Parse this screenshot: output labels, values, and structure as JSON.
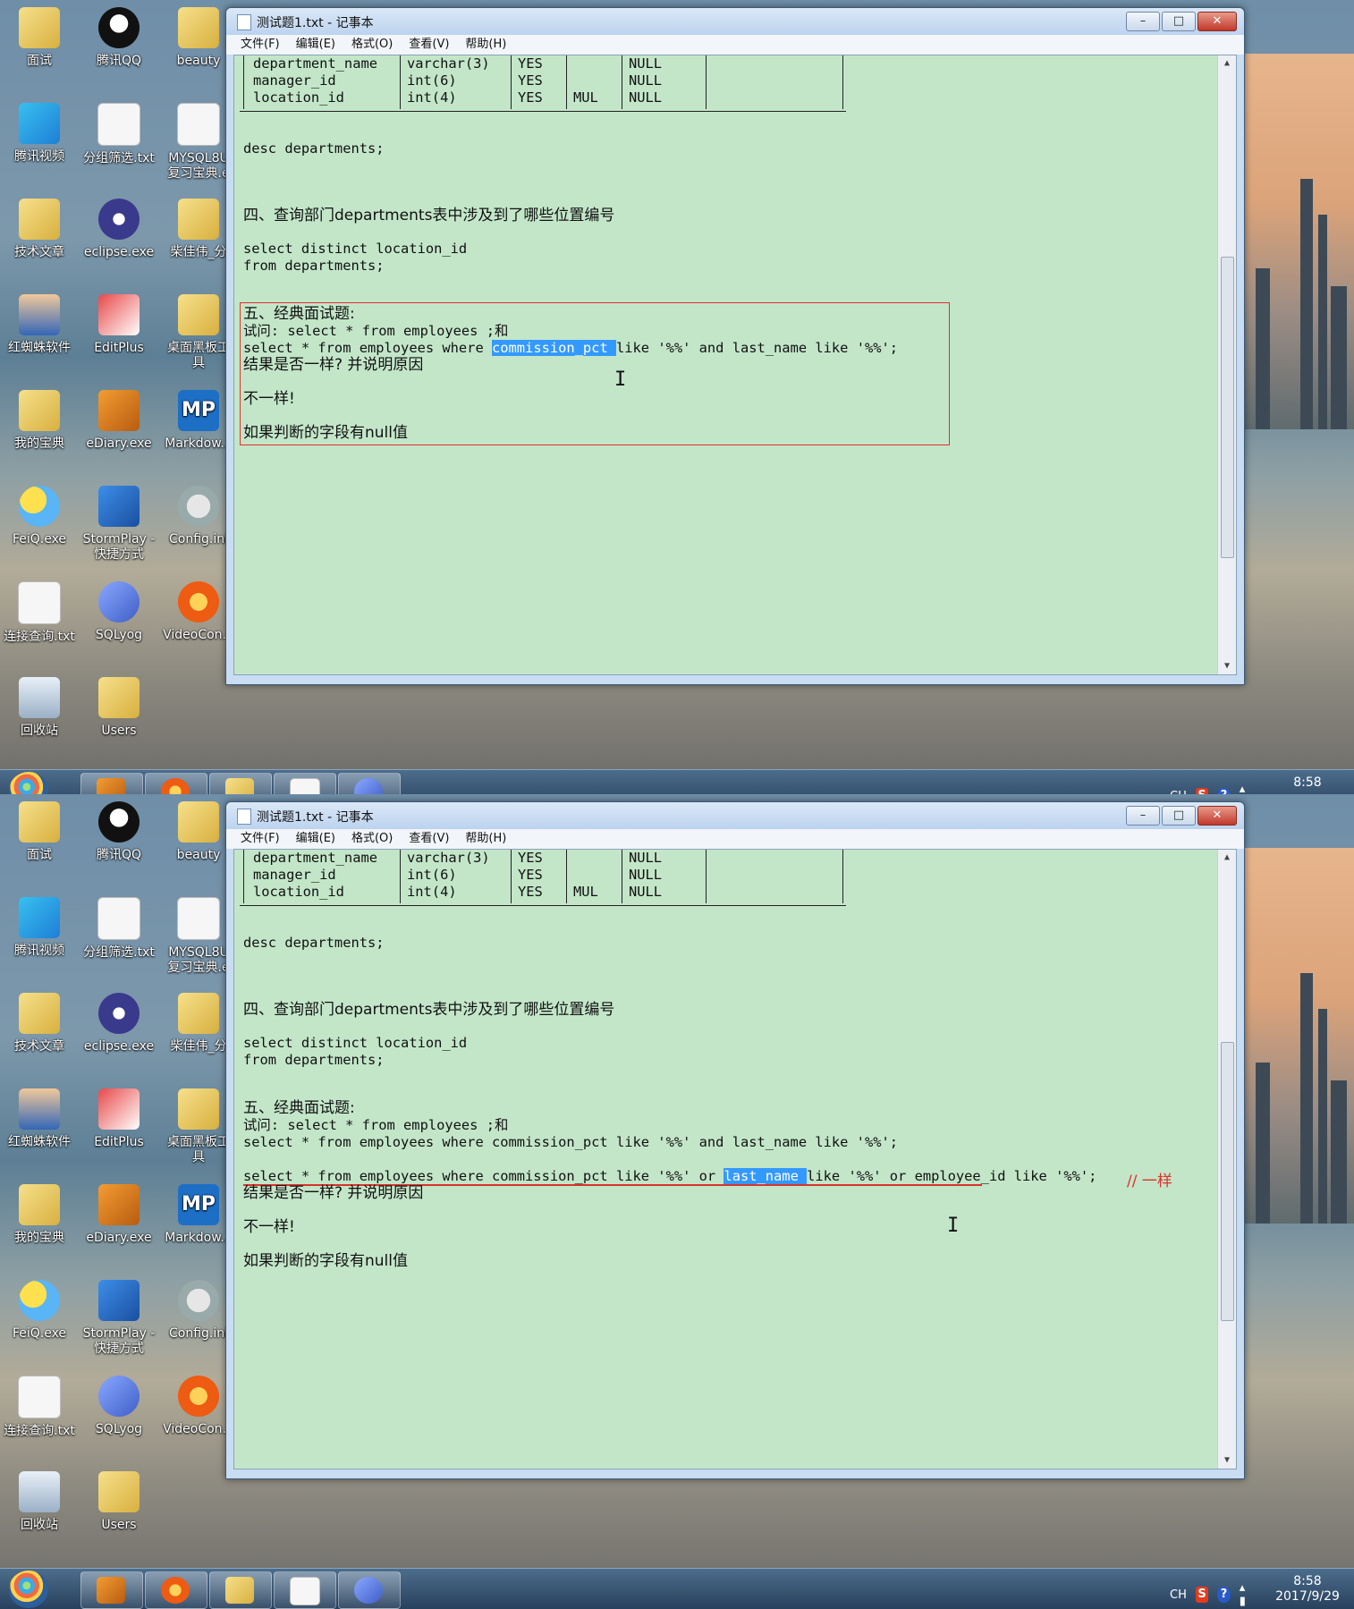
{
  "desktop_icons": [
    {
      "label": "面试",
      "icon": "folder-icon"
    },
    {
      "label": "腾讯QQ",
      "icon": "qq-penguin-icon"
    },
    {
      "label": "beauty",
      "icon": "folder-icon"
    },
    {
      "label": "腾讯视频",
      "icon": "video-play-icon"
    },
    {
      "label": "分组筛选.txt",
      "icon": "text-file-icon"
    },
    {
      "label": "MYSQL8U 复习宝典.e",
      "icon": "document-icon"
    },
    {
      "label": "技术文章",
      "icon": "folder-icon"
    },
    {
      "label": "eclipse.exe",
      "icon": "eclipse-icon"
    },
    {
      "label": "柴佳伟_分",
      "icon": "folder-icon"
    },
    {
      "label": "红蜘蛛软件",
      "icon": "person-icon"
    },
    {
      "label": "EditPlus",
      "icon": "editplus-icon"
    },
    {
      "label": "桌面黑板工 具",
      "icon": "folder-icon"
    },
    {
      "label": "我的宝典",
      "icon": "folder-icon"
    },
    {
      "label": "eDiary.exe",
      "icon": "diary-book-icon"
    },
    {
      "label": "Markdow...",
      "icon": "markdown-mp-icon"
    },
    {
      "label": "FeiQ.exe",
      "icon": "feiq-icon"
    },
    {
      "label": "StormPlay - 快捷方式",
      "icon": "stormplayer-icon"
    },
    {
      "label": "Config.ini",
      "icon": "config-gear-icon"
    },
    {
      "label": "连接查询.txt",
      "icon": "text-file-icon"
    },
    {
      "label": "SQLyog",
      "icon": "sqlyog-dolphin-icon"
    },
    {
      "label": "VideoCon...",
      "icon": "videoconverter-icon"
    },
    {
      "label": "回收站",
      "icon": "recycle-bin-icon"
    },
    {
      "label": "Users",
      "icon": "folder-icon"
    }
  ],
  "window": {
    "title": "测试题1.txt - 记事本",
    "buttons": {
      "minimize": "–",
      "maximize": "□",
      "close": "✕"
    },
    "menus": [
      "文件(F)",
      "编辑(E)",
      "格式(O)",
      "查看(V)",
      "帮助(H)"
    ]
  },
  "desc_table": {
    "rows": [
      [
        "department_name",
        "varchar(3)",
        "YES",
        "",
        "NULL",
        ""
      ],
      [
        "manager_id",
        "int(6)",
        "YES",
        "",
        "NULL",
        ""
      ],
      [
        "location_id",
        "int(4)",
        "YES",
        "MUL",
        "NULL",
        ""
      ]
    ]
  },
  "top_editor": {
    "desc": "desc departments;",
    "q4_title": "四、查询部门departments表中涉及到了哪些位置编号",
    "q4_sql1": "select distinct location_id",
    "q4_sql2": "from departments;",
    "q5_title": "五、经典面试题:",
    "q5_ask": "试问: select * from employees ;和",
    "q5_sql_a": "select * from employees where ",
    "q5_sql_sel": "commission_pct ",
    "q5_sql_b": "like '%%' and last_name like '%%';",
    "q5_result": "结果是否一样? 并说明原因",
    "answer": "不一样!",
    "reason": "如果判断的字段有null值"
  },
  "bottom_editor": {
    "desc": "desc departments;",
    "q4_title": "四、查询部门departments表中涉及到了哪些位置编号",
    "q4_sql1": "select distinct location_id",
    "q4_sql2": "from departments;",
    "q5_title": "五、经典面试题:",
    "q5_ask": "试问: select * from employees ;和",
    "q5_sql": "select * from employees where commission_pct like '%%' and last_name like '%%';",
    "q5_sql2_a": "select * from employees where commission_pct like '%%' or ",
    "q5_sql2_sel": "last_name ",
    "q5_sql2_b": "like '%%' or employee_id like '%%';",
    "annotation": "// 一样",
    "q5_result": "结果是否一样? 并说明原因",
    "answer": "不一样!",
    "reason": "如果判断的字段有null值"
  },
  "taskbar": {
    "apps": [
      "ediary-icon",
      "flame-app-icon",
      "explorer-folder-icon",
      "notepad-icon",
      "sqlyog-dolphin-icon"
    ],
    "ime": "CH",
    "sogou": "S",
    "help": "?",
    "time": "8:58",
    "date": "2017/9/29"
  },
  "colors": {
    "editor_bg": "#c3e6c9",
    "selection": "#3399ff",
    "annotation_red": "#e0302c"
  }
}
